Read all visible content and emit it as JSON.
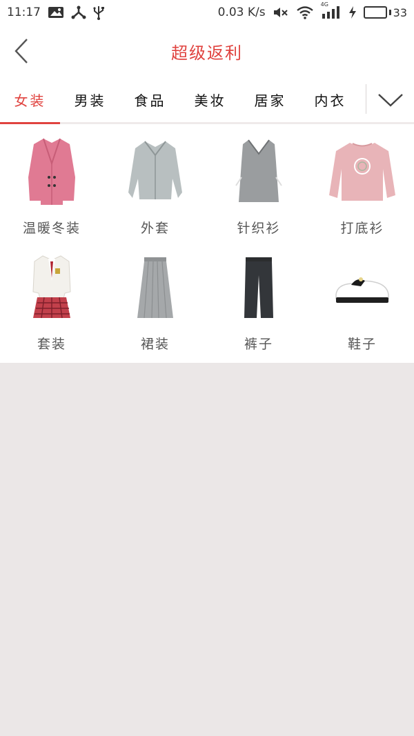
{
  "status_bar": {
    "time": "11:17",
    "speed": "0.03 K/s",
    "network": "4G",
    "battery": "33",
    "battery_fraction": 0.33,
    "battery_color": "#22b24c",
    "icons": [
      "image-icon",
      "share-node-icon",
      "usb-icon",
      "mute-icon",
      "wifi-icon",
      "signal-icon",
      "charging-icon",
      "battery-icon"
    ]
  },
  "header": {
    "title": "超级返利",
    "back_icon": "chevron-left-icon",
    "title_color": "#e0433f"
  },
  "tabs": {
    "items": [
      {
        "label": "女装",
        "active": true
      },
      {
        "label": "男装",
        "active": false
      },
      {
        "label": "食品",
        "active": false
      },
      {
        "label": "美妆",
        "active": false
      },
      {
        "label": "居家",
        "active": false
      },
      {
        "label": "内衣",
        "active": false
      }
    ],
    "expand_icon": "chevron-down-icon"
  },
  "categories": [
    {
      "label": "温暖冬装",
      "icon": "pink-coat-icon"
    },
    {
      "label": "外套",
      "icon": "jacket-icon"
    },
    {
      "label": "针织衫",
      "icon": "knit-vest-icon"
    },
    {
      "label": "打底衫",
      "icon": "sweatshirt-icon"
    },
    {
      "label": "套装",
      "icon": "uniform-suit-icon"
    },
    {
      "label": "裙装",
      "icon": "skirt-icon"
    },
    {
      "label": "裤子",
      "icon": "trousers-icon"
    },
    {
      "label": "鞋子",
      "icon": "shoe-icon"
    }
  ]
}
